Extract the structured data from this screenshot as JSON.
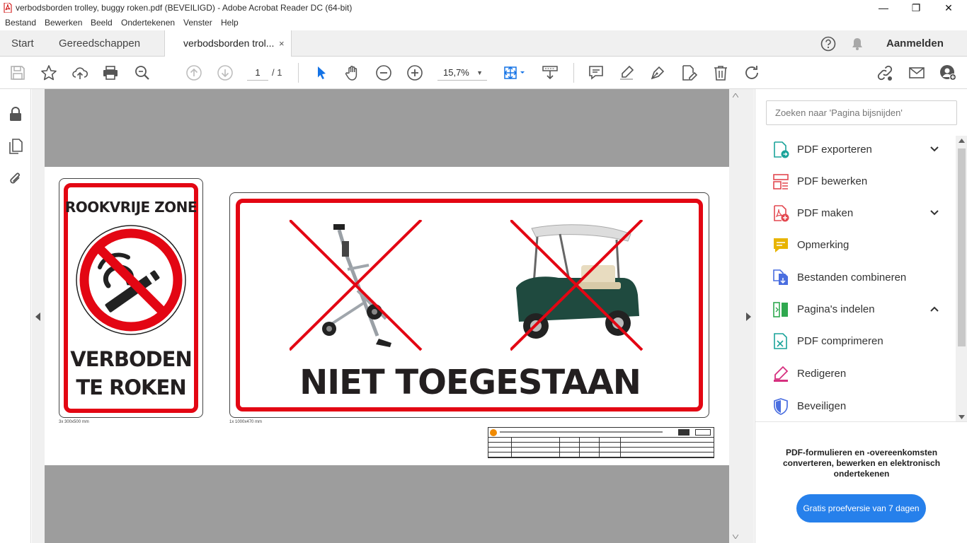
{
  "window": {
    "title": "verbodsborden trolley, buggy roken.pdf (BEVEILIGD) - Adobe Acrobat Reader DC (64-bit)",
    "minimize": "—",
    "maximize": "❐",
    "close": "✕"
  },
  "menu": [
    "Bestand",
    "Bewerken",
    "Beeld",
    "Ondertekenen",
    "Venster",
    "Help"
  ],
  "tabs": {
    "start": "Start",
    "tools": "Gereedschappen",
    "doc": "verbodsborden trol...",
    "doc_close": "×",
    "signin": "Aanmelden"
  },
  "toolbar": {
    "page_current": "1",
    "page_total": "/ 1",
    "zoom": "15,7%"
  },
  "document": {
    "sign1_top": "ROOKVRIJE ZONE",
    "sign1_line1": "VERBODEN",
    "sign1_line2": "TE ROKEN",
    "sign1_note": "3x 300x500 mm",
    "sign2_text": "NIET TOEGESTAAN",
    "sign2_note": "1x 1000x470 mm"
  },
  "right_panel": {
    "search_placeholder": "Zoeken naar 'Pagina bijsnijden'",
    "tools": [
      {
        "label": "PDF exporteren",
        "icon": "export-pdf-icon",
        "color": "#1aa39a",
        "chevron": "down"
      },
      {
        "label": "PDF bewerken",
        "icon": "edit-pdf-icon",
        "color": "#e34850",
        "chevron": ""
      },
      {
        "label": "PDF maken",
        "icon": "create-pdf-icon",
        "color": "#e34850",
        "chevron": "down"
      },
      {
        "label": "Opmerking",
        "icon": "comment-icon",
        "color": "#e8b400",
        "chevron": ""
      },
      {
        "label": "Bestanden combineren",
        "icon": "combine-files-icon",
        "color": "#4a6ee0",
        "chevron": ""
      },
      {
        "label": "Pagina's indelen",
        "icon": "organize-pages-icon",
        "color": "#2fa84f",
        "chevron": "up"
      },
      {
        "label": "PDF comprimeren",
        "icon": "compress-pdf-icon",
        "color": "#1aa39a",
        "chevron": ""
      },
      {
        "label": "Redigeren",
        "icon": "redact-icon",
        "color": "#d6307f",
        "chevron": ""
      },
      {
        "label": "Beveiligen",
        "icon": "protect-icon",
        "color": "#4a6ee0",
        "chevron": ""
      }
    ],
    "promo_text": "PDF-formulieren en -overeenkomsten\nconverteren, bewerken en elektronisch\nondertekenen",
    "promo_button": "Gratis proefversie van 7 dagen"
  },
  "colors": {
    "accent": "#2680eb",
    "sign_red": "#e30613",
    "viewer_gray": "#9d9d9d"
  }
}
